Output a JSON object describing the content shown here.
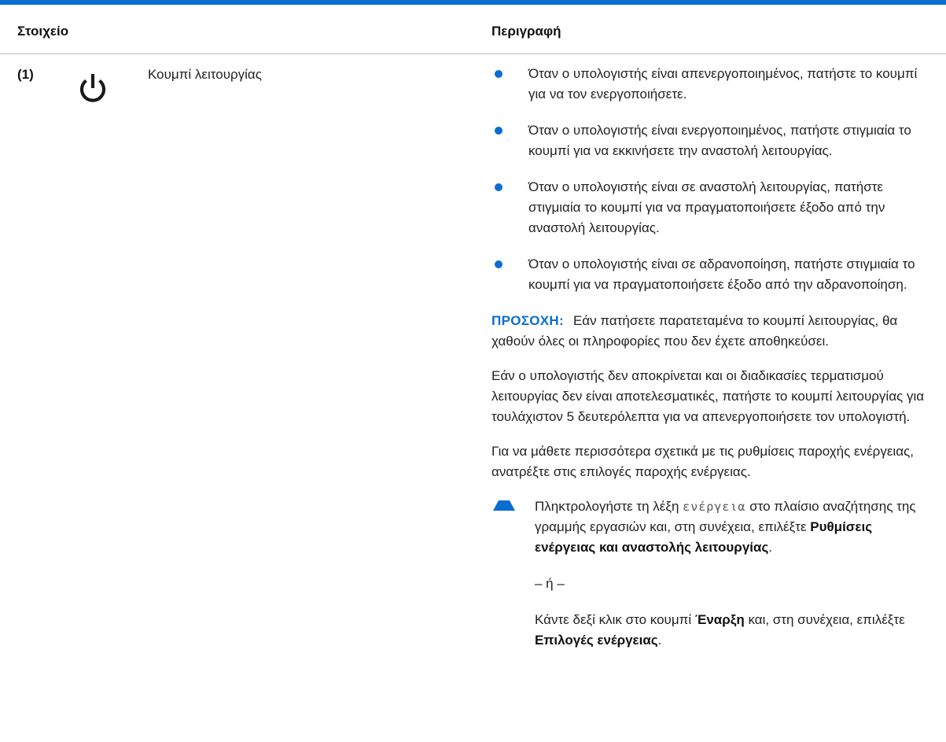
{
  "table": {
    "header_component": "Στοιχείο",
    "header_description": "Περιγραφή"
  },
  "row": {
    "number": "(1)",
    "icon": "power-icon",
    "component_name": "Κουμπί λειτουργίας",
    "bullets": [
      "Όταν ο υπολογιστής είναι απενεργοποιημένος, πατήστε το κουμπί για να τον ενεργοποιήσετε.",
      "Όταν ο υπολογιστής είναι ενεργοποιημένος, πατήστε στιγμιαία το κουμπί για να εκκινήσετε την αναστολή λειτουργίας.",
      "Όταν ο υπολογιστής είναι σε αναστολή λειτουργίας, πατήστε στιγμιαία το κουμπί για να πραγματοποιήσετε έξοδο από την αναστολή λειτουργίας.",
      "Όταν ο υπολογιστής είναι σε αδρανοποίηση, πατήστε στιγμιαία το κουμπί για να πραγματοποιήσετε έξοδο από την αδρανοποίηση."
    ],
    "caution_label": "ΠΡΟΣΟΧΗ:",
    "caution_text": "Εάν πατήσετε παρατεταμένα το κουμπί λειτουργίας, θα χαθούν όλες οι πληροφορίες που δεν έχετε αποθηκεύσει.",
    "para_unresponsive": "Εάν ο υπολογιστής δεν αποκρίνεται και οι διαδικασίες τερματισμού λειτουργίας δεν είναι αποτελεσματικές, πατήστε το κουμπί λειτουργίας για τουλάχιστον 5 δευτερόλεπτα για να απενεργοποιήσετε τον υπολογιστή.",
    "para_more": "Για να μάθετε περισσότερα σχετικά με τις ρυθμίσεις παροχής ενέργειας, ανατρέξτε στις επιλογές παροχής ενέργειας.",
    "step": {
      "part1": "Πληκτρολογήστε τη λέξη ",
      "keyword": "ενέργεια",
      "part2": " στο πλαίσιο αναζήτησης της γραμμής εργασιών και, στη συνέχεια, επιλέξτε ",
      "bold1": "Ρυθμίσεις ενέργειας και αναστολής λειτουργίας",
      "part3": ".",
      "or": "– ή –",
      "alt_part1": "Κάντε δεξί κλικ στο κουμπί ",
      "alt_bold1": "Έναρξη",
      "alt_part2": " και, στη συνέχεια, επιλέξτε ",
      "alt_bold2": "Επιλογές ενέργειας",
      "alt_part3": "."
    }
  },
  "colors": {
    "accent": "#0a6ed1"
  }
}
